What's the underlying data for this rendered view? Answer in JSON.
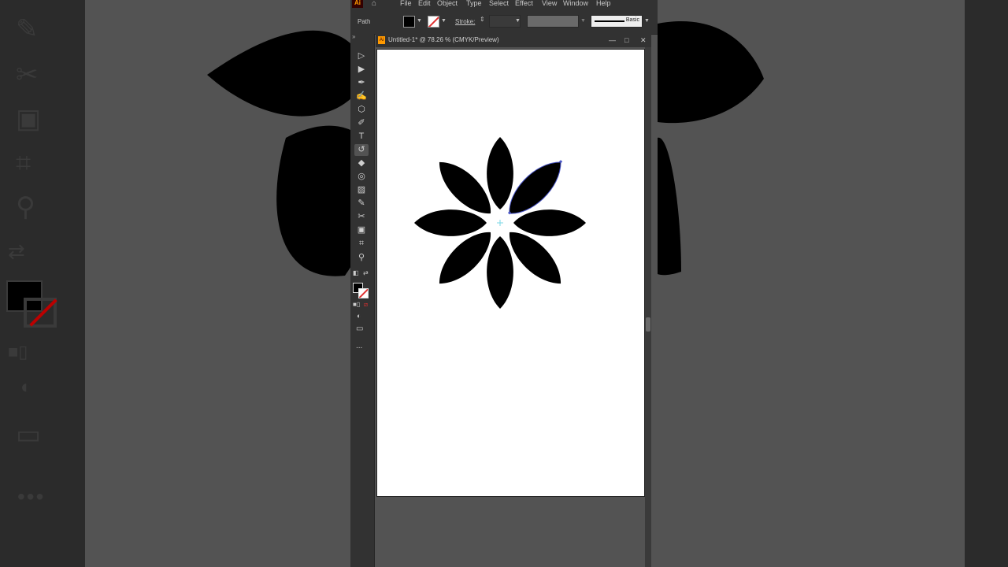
{
  "menu": {
    "items": [
      "File",
      "Edit",
      "Object",
      "Type",
      "Select",
      "Effect",
      "View",
      "Window",
      "Help"
    ]
  },
  "control_bar": {
    "selection_label": "Path",
    "stroke_label": "Stroke:",
    "brush_label": "Basic"
  },
  "document": {
    "tab_title": "Untitled-1* @ 78.26 % (CMYK/Preview)"
  },
  "toolbar": {
    "tools": [
      "selection-tool",
      "direct-selection-tool",
      "pen-tool",
      "curvature-tool",
      "shape-tool",
      "paintbrush-tool",
      "type-tool",
      "rotate-tool",
      "eraser-tool",
      "shape-builder-tool",
      "gradient-tool",
      "eyedropper-tool",
      "blend-tool",
      "symbol-sprayer-tool",
      "artboard-tool",
      "zoom-tool"
    ],
    "more_label": "..."
  },
  "colors": {
    "app_bg": "#323232",
    "canvas_bg": "#535353",
    "artboard": "#ffffff",
    "fill": "#000000",
    "selection_outline": "#4a56c8",
    "ai_logo": "#ff9a00"
  },
  "canvas": {
    "artwork": "eight-petal-flower"
  }
}
